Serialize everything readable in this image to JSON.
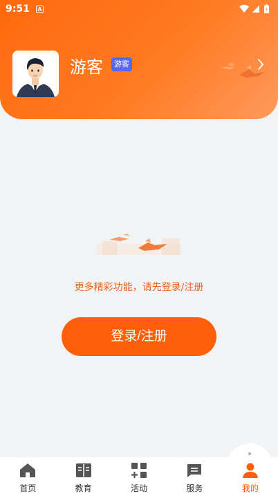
{
  "status": {
    "time": "9:51",
    "a_label": "A"
  },
  "profile": {
    "username": "游客",
    "badge": "游客"
  },
  "main": {
    "prompt": "更多精彩功能，请先登录/注册",
    "login_button": "登录/注册"
  },
  "tabbar": {
    "items": [
      {
        "label": "首页",
        "icon": "home-icon"
      },
      {
        "label": "教育",
        "icon": "book-icon"
      },
      {
        "label": "活动",
        "icon": "grid-icon"
      },
      {
        "label": "服务",
        "icon": "chat-icon"
      },
      {
        "label": "我的",
        "icon": "person-icon"
      }
    ],
    "active_index": 4
  },
  "colors": {
    "accent": "#ff5f0a",
    "badge": "#5867f0",
    "prompt_text": "#f0641a"
  }
}
